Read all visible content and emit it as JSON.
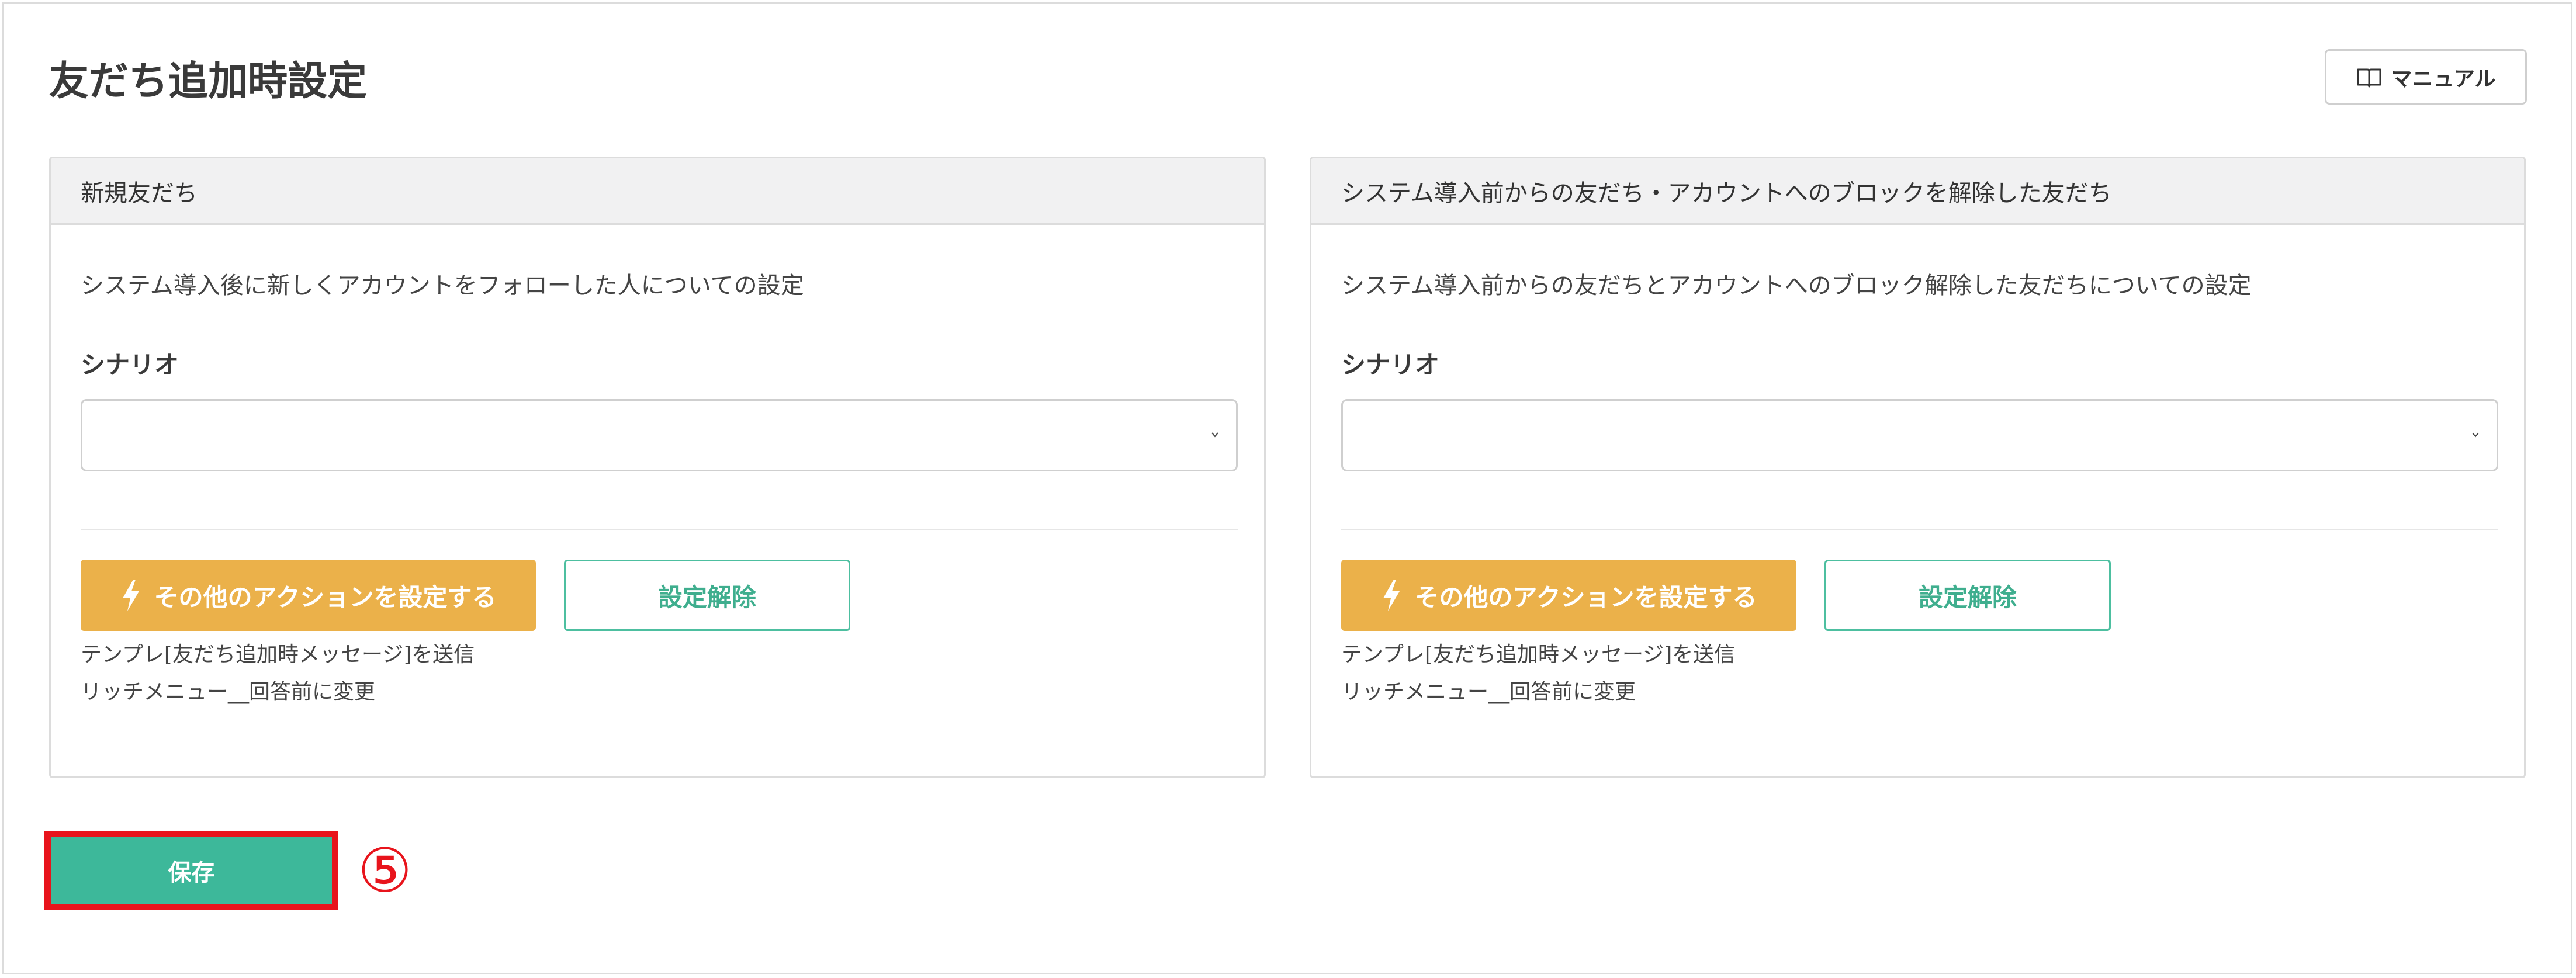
{
  "page": {
    "title": "友だち追加時設定",
    "manual_button": "マニュアル",
    "manual_icon": "book-icon"
  },
  "cards": {
    "new_friends": {
      "header": "新規友だち",
      "description": "システム導入後に新しくアカウントをフォローした人についての設定",
      "scenario_label": "シナリオ",
      "scenario_value": "",
      "action_button": "その他のアクションを設定する",
      "clear_button": "設定解除",
      "actions": [
        "テンプレ[友だち追加時メッセージ]を送信",
        "リッチメニュー__回答前に変更"
      ]
    },
    "existing_friends": {
      "header": "システム導入前からの友だち・アカウントへのブロックを解除した友だち",
      "description": "システム導入前からの友だちとアカウントへのブロック解除した友だちについての設定",
      "scenario_label": "シナリオ",
      "scenario_value": "",
      "action_button": "その他のアクションを設定する",
      "clear_button": "設定解除",
      "actions": [
        "テンプレ[友だち追加時メッセージ]を送信",
        "リッチメニュー__回答前に変更"
      ]
    }
  },
  "footer": {
    "save_button": "保存",
    "step_marker": "⑤"
  },
  "colors": {
    "action_button": "#ebb14a",
    "clear_button_border": "#4dbfa0",
    "save_button": "#3db89a",
    "highlight": "#e8141c",
    "header_bg": "#f1f1f2"
  }
}
